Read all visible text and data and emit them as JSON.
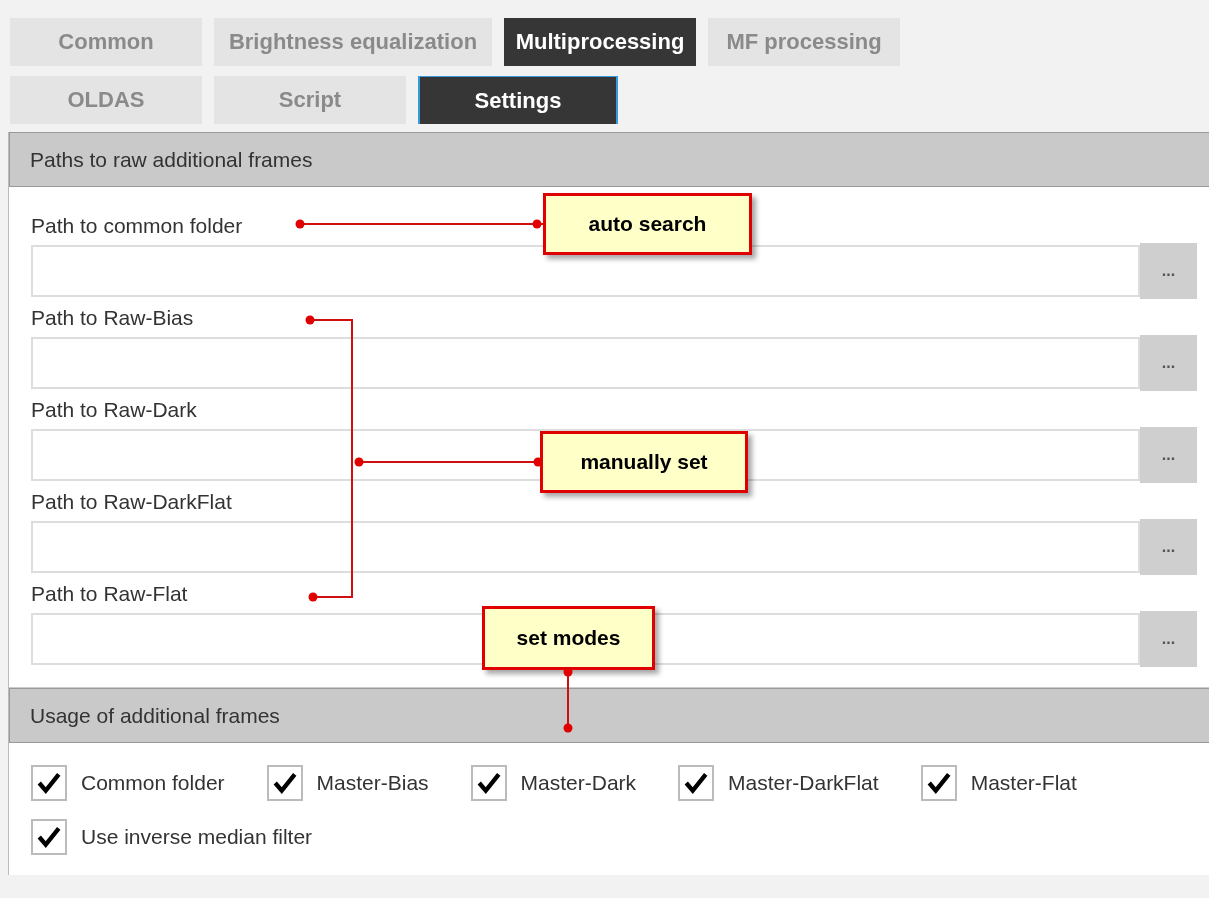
{
  "tab_rows": [
    [
      {
        "label": "Common",
        "selected": false,
        "focused": false
      },
      {
        "label": "Brightness equalization",
        "selected": false,
        "focused": false
      },
      {
        "label": "Multiprocessing",
        "selected": true,
        "focused": false
      },
      {
        "label": "MF processing",
        "selected": false,
        "focused": false
      }
    ],
    [
      {
        "label": "OLDAS",
        "selected": false,
        "focused": false
      },
      {
        "label": "Script",
        "selected": false,
        "focused": false
      },
      {
        "label": "Settings",
        "selected": true,
        "focused": true
      }
    ]
  ],
  "sections": [
    {
      "title": "Paths to raw additional frames",
      "kind": "paths",
      "fields": [
        {
          "label": "Path to common folder",
          "button": "..."
        },
        {
          "label": "Path to Raw-Bias",
          "button": "..."
        },
        {
          "label": "Path to Raw-Dark",
          "button": "..."
        },
        {
          "label": "Path to Raw-DarkFlat",
          "button": "..."
        },
        {
          "label": "Path to Raw-Flat",
          "button": "..."
        }
      ]
    },
    {
      "title": "Usage of additional frames",
      "kind": "checks",
      "checkboxes": [
        {
          "label": "Common folder",
          "checked": true
        },
        {
          "label": "Master-Bias",
          "checked": true
        },
        {
          "label": "Master-Dark",
          "checked": true
        },
        {
          "label": "Master-DarkFlat",
          "checked": true
        },
        {
          "label": "Master-Flat",
          "checked": true
        },
        {
          "label": "Use inverse median filter",
          "checked": true
        }
      ]
    }
  ],
  "annotations": [
    {
      "text": "auto search"
    },
    {
      "text": "manually set"
    },
    {
      "text": "set modes"
    }
  ]
}
